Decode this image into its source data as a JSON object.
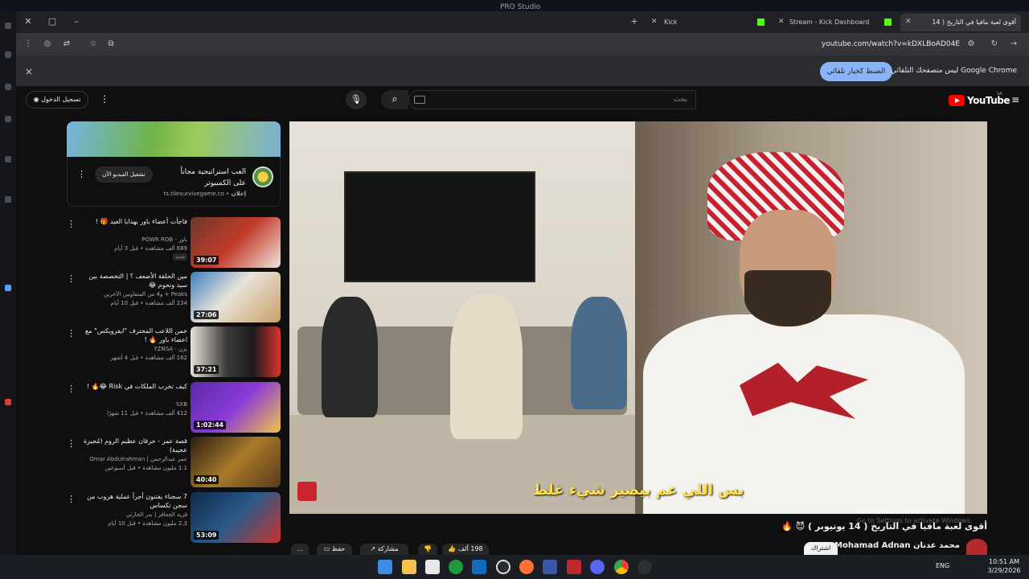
{
  "os": {
    "window_title": "PRO Studio"
  },
  "browser": {
    "tabs": [
      {
        "label": "أقوى لعبة مافيا في التاريخ ( 14",
        "active": true
      },
      {
        "label": "Stream - Kick Dashboard",
        "active": false
      },
      {
        "label": "Kick",
        "active": false
      }
    ],
    "new_tab": "+",
    "url": "youtube.com/watch?v=kDXLBoAD04E",
    "infobar": {
      "message": "Google Chrome ليس متصفحك التلقائي",
      "button": "الضبط كخيار تلقائي",
      "close": "×"
    }
  },
  "youtube": {
    "logo": "YouTube",
    "country": "SA",
    "search_placeholder": "بحث",
    "signin": "تسجيل الدخول",
    "ad": {
      "title": "العب استراتيجية مجاناً على الكمبيوتر",
      "sponsor": "إعلان",
      "url": "ts.tilesurvivegame.co",
      "cta": "تشغيل الفيديو الآن"
    },
    "video": {
      "subtitle": "بس اللي عم بيصير شيء غلط",
      "title": "أقوى لعبة مافيا في التاريخ ( 14 يوتيوبر ) 😈 🔥",
      "channel": "محمد عدنان Mohamad Adnan",
      "subscribe": "اشتراك",
      "likes": "198 ألف",
      "share": "مشاركة",
      "save": "حفظ",
      "more": "..."
    },
    "recommendations": [
      {
        "title": "فاجأت أعضاء باور بهدايا العيد 🎁 !",
        "channel": "باور - POWR ROB",
        "meta": "689 ألف مشاهدة • قبل 3 أيام",
        "badge": "جديد",
        "duration": "39:07"
      },
      {
        "title": "مين الحلقة الأضعف ؟ | التخصصة بين سيد ونحوم 😂",
        "channel": "Peaks + و4 من المتعاونين الآخرين",
        "meta": "234 ألف مشاهدة • قبل 10 أيام",
        "badge": "",
        "duration": "27:06"
      },
      {
        "title": "خمن اللاعب المحترف \"ايفروبكس\" مع اعضاء باور 🔥 !",
        "channel": "يزن - YZNSA",
        "meta": "162 ألف مشاهدة • قبل 4 أشهر",
        "badge": "",
        "duration": "37:21"
      },
      {
        "title": "كيف تخرب الملكات في Risk 😂🔥 !",
        "channel": "SXB",
        "meta": "412 ألف مشاهدة • قبل 11 شهرًا",
        "badge": "",
        "duration": "1:02:44"
      },
      {
        "title": "قصة عمر - حرقان عظيم الروم (مُجيزة عجيبة)",
        "channel": "عمر عبدالرحمن | Omar Abdulrahman",
        "meta": "1.1 مليون مشاهدة • قبل أسبوعين",
        "badge": "",
        "duration": "40:40"
      },
      {
        "title": "7 سجناء يفتنون أجرأ عملية هروب من سجن تكساس",
        "channel": "قرية الجعافر | بدر الحارثي",
        "meta": "2.3 مليون مشاهدة • قبل 10 أيام",
        "badge": "",
        "duration": "53:09"
      }
    ],
    "player_watermark": "Activate Windows",
    "player_watermark_sub": "Go to Settings to activate Windows."
  },
  "taskbar": {
    "lang": "ENG",
    "time": "10:51 AM",
    "date": "3/29/2026"
  }
}
